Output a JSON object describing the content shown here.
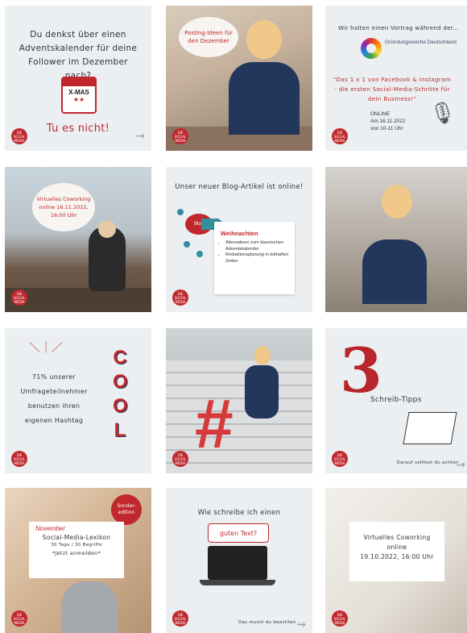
{
  "logo_text": "DIE SOCIAL MEDIA",
  "tiles": [
    {
      "title": "Du denkst über einen Adventskalender für deine Follower im Dezember nach?",
      "calendar": "X-MAS",
      "cta": "Tu es nicht!"
    },
    {
      "bubble": "Posting-Ideen für den Dezember"
    },
    {
      "heading": "Wir halten einen Vortrag während der...",
      "org": "Gründungswoche Deutschland",
      "body": "\"Das 1 x 1 von Facebook & Instagram - die ersten Social-Media-Schritte für dein Business!\"",
      "online": "ONLINE",
      "date": "Am 16.11.2022",
      "time": "von 10-11 Uhr"
    },
    {
      "bubble": "Virtuelles Coworking online 16.11.2022, 16:00 Uhr"
    },
    {
      "heading": "Unser neuer Blog-Artikel ist online!",
      "blob": "Blog",
      "card_title": "Weihnachten",
      "items": [
        "Alternativen zum klassischen Adventskalender",
        "Redaktionsplanung in lebhaften Zeiten"
      ]
    },
    {},
    {
      "lines": [
        "71% unserer",
        "Umfrageteilnehmer",
        "benutzen ihren",
        "eigenen Hashtag"
      ],
      "cool": [
        "C",
        "O",
        "O",
        "L"
      ]
    },
    {
      "symbol": "#"
    },
    {
      "number": "3",
      "title": "Schreib-Tipps",
      "footer": "Darauf solltest du achten ..."
    },
    {
      "badge": "Sonder-edition",
      "month": "November",
      "lexikon": "Social-Media-Lexikon",
      "meta": "30 Tage / 30 Begriffe",
      "join": "*Jetzt anmelden*"
    },
    {
      "heading": "Wie schreibe ich einen",
      "highlight": "guten Text?",
      "footer": "Das musst du beachten ..."
    },
    {
      "lines": [
        "Virtuelles Coworking",
        "online",
        "19.10.2022, 16:00 Uhr"
      ]
    }
  ],
  "colors": {
    "accent": "#c0282d",
    "navy": "#23365c",
    "bg": "#eceff1"
  }
}
